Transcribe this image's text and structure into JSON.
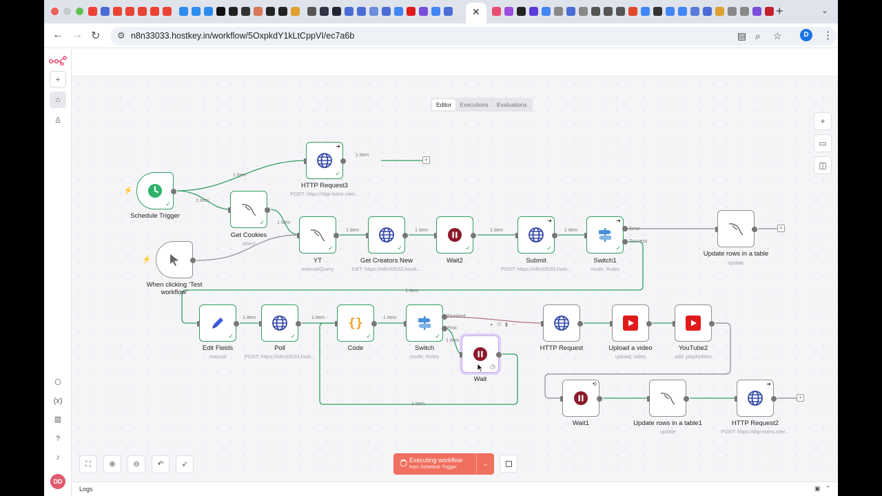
{
  "browser": {
    "url": "n8n33033.hostkey.in/workflow/5OxpkdY1kLtCppVI/ec7a6b",
    "close_tab": "✕",
    "new_tab": "+",
    "profile_initial": "D"
  },
  "app": {
    "avatar_initials": "DD",
    "view_tabs": [
      "Editor",
      "Executions",
      "Evaluations"
    ],
    "active_view": "Editor"
  },
  "nodes": {
    "schedule_trigger": {
      "label": "Schedule Trigger",
      "sub": ""
    },
    "http_request3": {
      "label": "HTTP Request3",
      "sub": "POST: https://digi-twins.site/..."
    },
    "get_cookies": {
      "label": "Get Cookies",
      "sub": "select"
    },
    "manual_trigger": {
      "label": "When clicking ‘Test workflow’",
      "sub": ""
    },
    "yt": {
      "label": "YT",
      "sub": "executeQuery"
    },
    "get_creators_new": {
      "label": "Get Creators New",
      "sub": "GET: https://n8n33033.hostk..."
    },
    "wait2": {
      "label": "Wait2",
      "sub": ""
    },
    "submit": {
      "label": "Submit",
      "sub": "POST: https://n8n33033.host..."
    },
    "switch1": {
      "label": "Switch1",
      "sub": "mode: Rules"
    },
    "update_rows": {
      "label": "Update rows in a table",
      "sub": "update"
    },
    "edit_fields": {
      "label": "Edit Fields",
      "sub": "manual"
    },
    "poll": {
      "label": "Poll",
      "sub": "POST: https://n8n33033.host..."
    },
    "code": {
      "label": "Code",
      "sub": ""
    },
    "switch": {
      "label": "Switch",
      "sub": "mode: Rules"
    },
    "wait": {
      "label": "Wait",
      "sub": ""
    },
    "http_request": {
      "label": "HTTP Request",
      "sub": ""
    },
    "upload_video": {
      "label": "Upload a video",
      "sub": "upload: video"
    },
    "youtube2": {
      "label": "YouTube2",
      "sub": "add: playlistItem"
    },
    "wait1": {
      "label": "Wait1",
      "sub": ""
    },
    "update_rows1": {
      "label": "Update rows in a table1",
      "sub": "update"
    },
    "http_request2": {
      "label": "HTTP Request2",
      "sub": "POST: https://digi-twins.site/..."
    }
  },
  "edges": {
    "item_label": "1 item",
    "switch1_error": "Error",
    "switch1_success": "Success",
    "switch_finished": "Finished",
    "switch_proc": "Proc"
  },
  "execute_button": {
    "title": "Executing workflow",
    "subtitle": "from Schedule Trigger"
  },
  "logs": {
    "label": "Logs"
  },
  "colors": {
    "success": "#2f9e5e",
    "execute": "#f06f5e",
    "wait_icon": "#8b1a2b",
    "youtube": "#e01a1a",
    "globe": "#3348a8",
    "code": "#f0a020",
    "switch": "#4a90d9",
    "edit": "#3a5bd9"
  }
}
